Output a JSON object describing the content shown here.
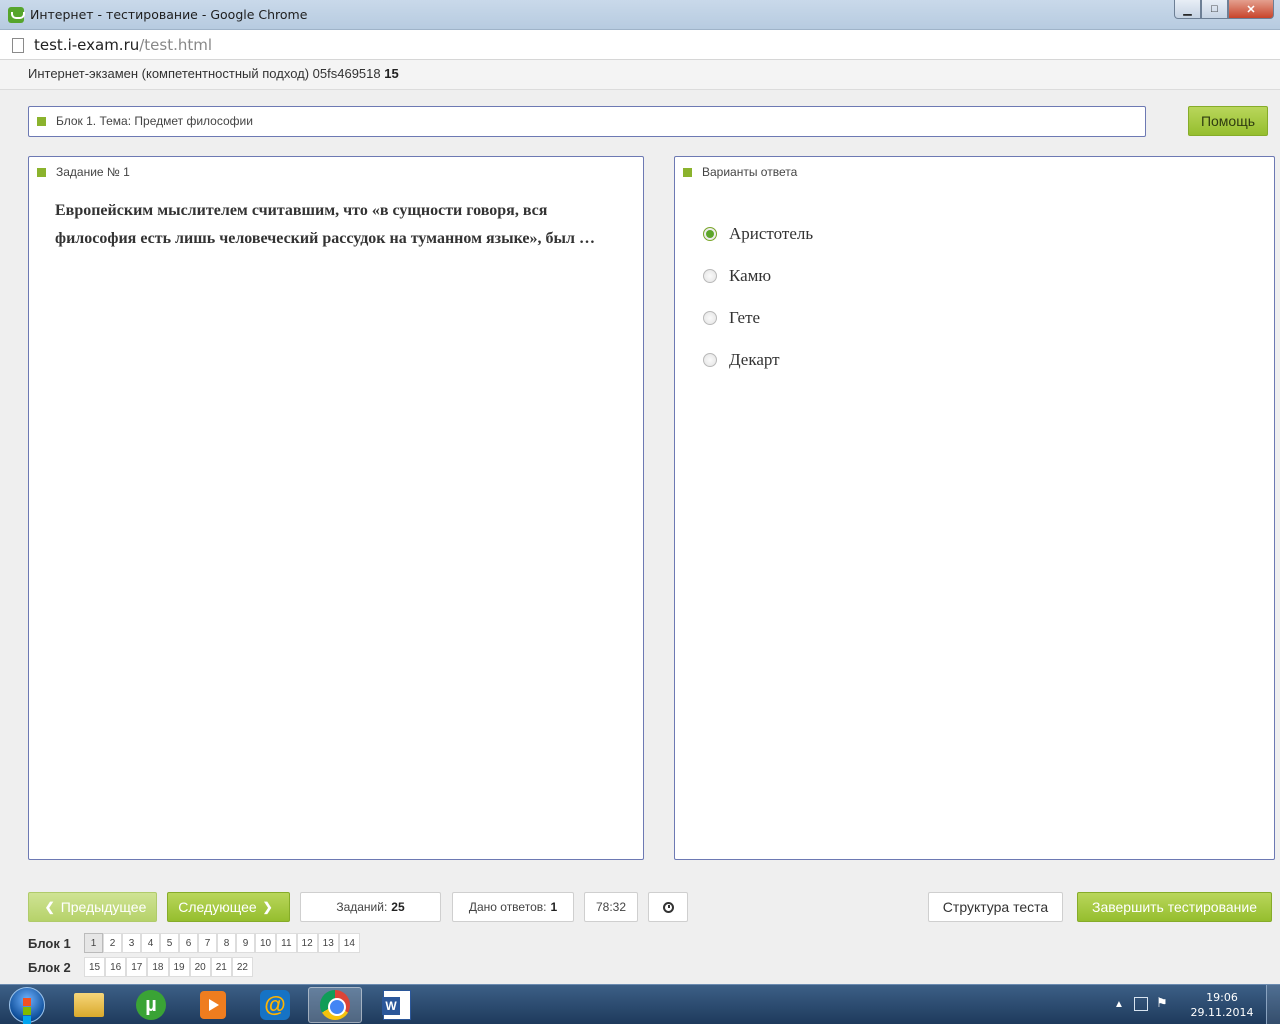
{
  "window": {
    "title": "Интернет - тестирование - Google Chrome",
    "min_label": "▁",
    "max_label": "□",
    "close_label": "✕"
  },
  "address": {
    "host": "test.i-exam.ru",
    "path": "/test.html"
  },
  "exam": {
    "title": "Интернет-экзамен (компетентностный подход) 05fs469518",
    "number": "15"
  },
  "block_bar": {
    "label": "Блок 1. Тема: Предмет философии"
  },
  "help_label": "Помощь",
  "task": {
    "header": "Задание № 1",
    "question": "Европейским мыслителем считавшим, что «в сущности говоря, вся философия есть лишь человеческий рассудок на туманном языке», был …"
  },
  "answers": {
    "header": "Варианты ответа",
    "options": [
      {
        "label": "Аристотель",
        "selected": true
      },
      {
        "label": "Камю",
        "selected": false
      },
      {
        "label": "Гете",
        "selected": false
      },
      {
        "label": "Декарт",
        "selected": false
      }
    ]
  },
  "controls": {
    "prev_label": "Предыдущее",
    "next_label": "Следующее",
    "tasks_label": "Заданий:",
    "tasks_value": "25",
    "answered_label": "Дано ответов:",
    "answered_value": "1",
    "timer": "78:32",
    "structure_label": "Структура теста",
    "finish_label": "Завершить тестирование"
  },
  "navigation": {
    "block1_label": "Блок 1",
    "block1_items": [
      "1",
      "2",
      "3",
      "4",
      "5",
      "6",
      "7",
      "8",
      "9",
      "10",
      "11",
      "12",
      "13",
      "14"
    ],
    "block2_label": "Блок 2",
    "block2_items": [
      "15",
      "16",
      "17",
      "18",
      "19",
      "20",
      "21",
      "22"
    ],
    "current": "1"
  },
  "taskbar": {
    "items": [
      "explorer-icon",
      "utorrent-icon",
      "media-player-icon",
      "mail-agent-icon",
      "chrome-icon",
      "word-icon"
    ],
    "active": "chrome-icon",
    "clock_time": "19:06",
    "clock_date": "29.11.2014"
  },
  "colors": {
    "accent_green": "#95be2e",
    "panel_border": "#6d79b3",
    "selected_radio": "#5ca52a"
  }
}
